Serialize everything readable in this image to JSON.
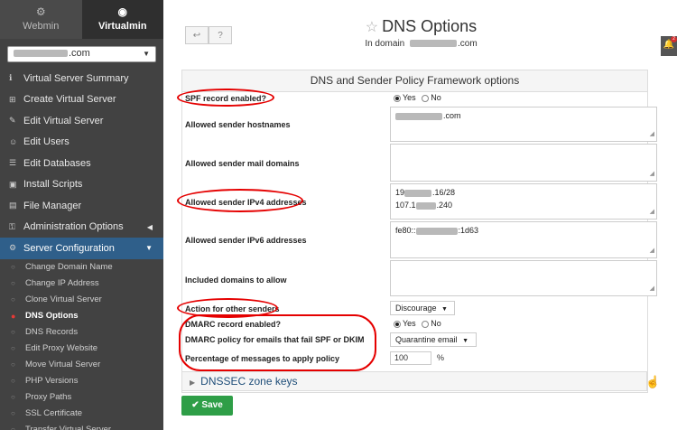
{
  "sidebar": {
    "tabs": [
      {
        "label": "Webmin",
        "icon": "cog-icon"
      },
      {
        "label": "Virtualmin",
        "icon": "globe-icon"
      }
    ],
    "domain_select": {
      "value": ".com"
    },
    "menu": [
      {
        "label": "Virtual Server Summary",
        "icon": "info-icon"
      },
      {
        "label": "Create Virtual Server",
        "icon": "plus-square-icon"
      },
      {
        "label": "Edit Virtual Server",
        "icon": "edit-icon"
      },
      {
        "label": "Edit Users",
        "icon": "users-icon"
      },
      {
        "label": "Edit Databases",
        "icon": "database-icon"
      },
      {
        "label": "Install Scripts",
        "icon": "terminal-icon"
      },
      {
        "label": "File Manager",
        "icon": "folder-icon"
      },
      {
        "label": "Administration Options",
        "icon": "key-icon"
      },
      {
        "label": "Server Configuration",
        "icon": "cogs-icon"
      }
    ],
    "submenu": [
      "Change Domain Name",
      "Change IP Address",
      "Clone Virtual Server",
      "DNS Options",
      "DNS Records",
      "Edit Proxy Website",
      "Move Virtual Server",
      "PHP Versions",
      "Proxy Paths",
      "SSL Certificate",
      "Transfer Virtual Server"
    ]
  },
  "header": {
    "title": "DNS Options",
    "subtitle_prefix": "In domain",
    "subtitle_suffix": ".com",
    "notification_count": "2"
  },
  "form": {
    "section_title": "DNS and Sender Policy Framework options",
    "spf_enabled_label": "SPF record enabled?",
    "yes": "Yes",
    "no": "No",
    "allowed_hostnames_label": "Allowed sender hostnames",
    "allowed_hostnames_value_suffix": ".com",
    "allowed_mail_domains_label": "Allowed sender mail domains",
    "ipv4_label": "Allowed sender IPv4 addresses",
    "ipv4_line1_a": "19",
    "ipv4_line1_b": ".16/28",
    "ipv4_line2_a": "107.1",
    "ipv4_line2_b": ".240",
    "ipv6_label": "Allowed sender IPv6 addresses",
    "ipv6_a": "fe80::",
    "ipv6_b": ":1d63",
    "included_domains_label": "Included domains to allow",
    "action_label": "Action for other senders",
    "action_value": "Discourage",
    "dmarc_enabled_label": "DMARC record enabled?",
    "dmarc_policy_label": "DMARC policy for emails that fail SPF or DKIM",
    "dmarc_policy_value": "Quarantine email",
    "percentage_label": "Percentage of messages to apply policy",
    "percentage_value": "100",
    "percent_sign": "%"
  },
  "dnssec_label": "DNSSEC zone keys",
  "save_label": "Save"
}
